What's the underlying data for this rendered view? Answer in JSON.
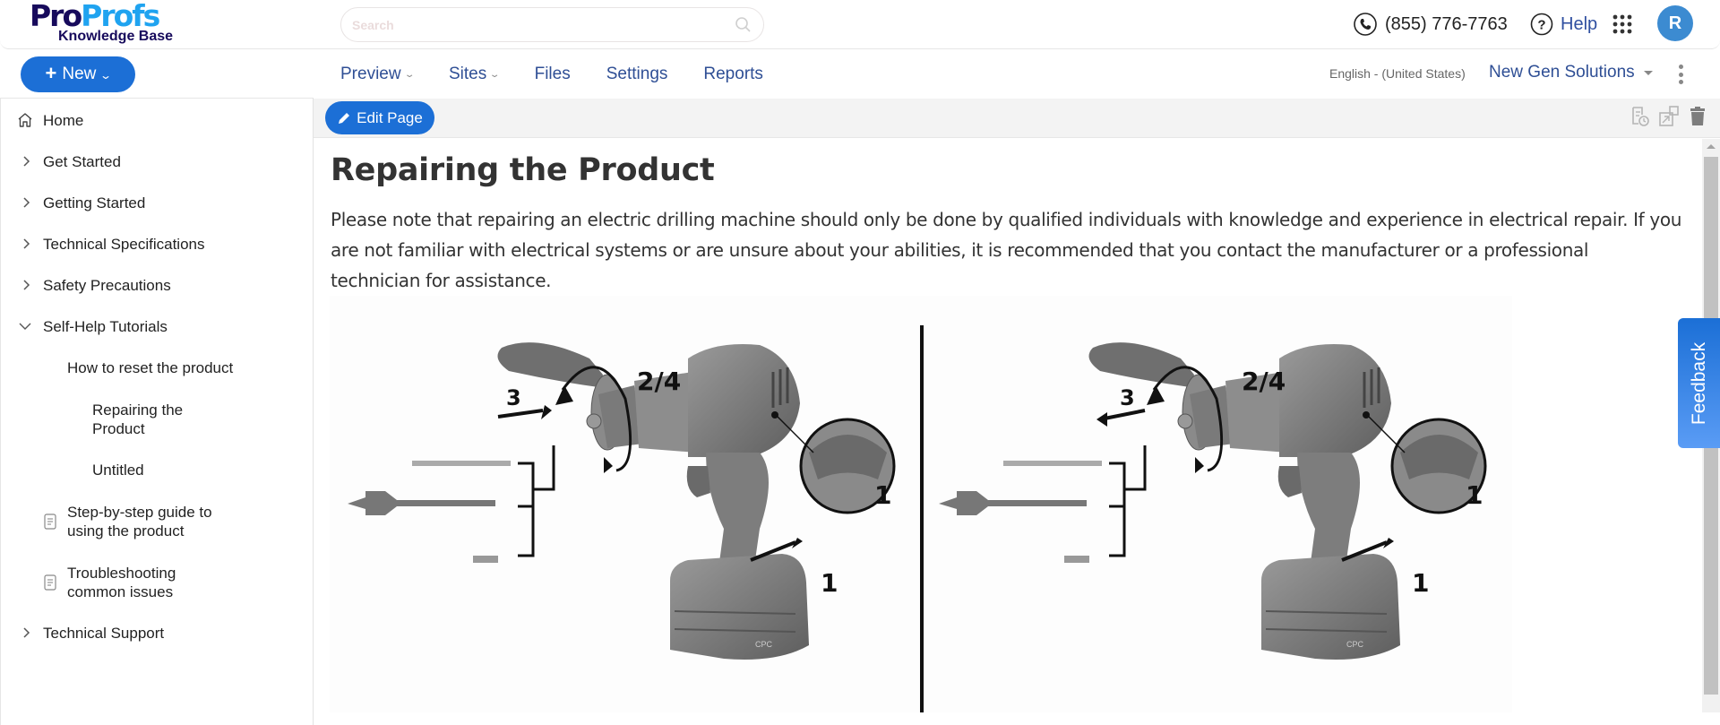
{
  "app": {
    "logo_pro": "Pro",
    "logo_profs": "Profs",
    "logo_subtitle": "Knowledge Base"
  },
  "header": {
    "search_placeholder": "Search",
    "search_value": "",
    "phone": "(855) 776-7763",
    "help_label": "Help",
    "avatar_initial": "R"
  },
  "nav": {
    "new_label": "New",
    "items": [
      {
        "label": "Preview",
        "dropdown": true
      },
      {
        "label": "Sites",
        "dropdown": true
      },
      {
        "label": "Files",
        "dropdown": false
      },
      {
        "label": "Settings",
        "dropdown": false
      },
      {
        "label": "Reports",
        "dropdown": false
      }
    ],
    "language": "English - (United States)",
    "organization": "New Gen Solutions"
  },
  "sidebar": {
    "items": [
      {
        "label": "Home",
        "icon": "home-icon",
        "level": 0
      },
      {
        "label": "Get Started",
        "icon": "chevron-right-icon",
        "level": 0
      },
      {
        "label": "Getting Started",
        "icon": "chevron-right-icon",
        "level": 0
      },
      {
        "label": "Technical Specifications",
        "icon": "chevron-right-icon",
        "level": 0
      },
      {
        "label": "Safety Precautions",
        "icon": "chevron-right-icon",
        "level": 0
      },
      {
        "label": "Self-Help Tutorials",
        "icon": "chevron-down-icon",
        "level": 0,
        "expanded": true
      },
      {
        "label": "How to reset the product",
        "level": 1
      },
      {
        "label": "Repairing the Product",
        "level": 2,
        "active": true
      },
      {
        "label": "Untitled",
        "level": 2
      },
      {
        "label": "Step-by-step guide to using the product",
        "icon": "document-icon",
        "level": 1
      },
      {
        "label": "Troubleshooting common issues",
        "icon": "document-icon",
        "level": 1
      },
      {
        "label": "Technical Support",
        "icon": "chevron-right-icon",
        "level": 0
      }
    ]
  },
  "toolbar": {
    "edit_label": "Edit Page",
    "icons": [
      "revision-history-icon",
      "open-external-icon",
      "trash-icon"
    ]
  },
  "article": {
    "title": "Repairing the Product",
    "paragraph": "Please note that repairing an electric drilling machine should only be done by qualified individuals with knowledge and experience in electrical repair. If you are not familiar with electrical systems or are unsure about your abilities, it is recommended that you contact the manufacturer or a professional technician for assistance.",
    "figure": {
      "description": "Two-panel diagram of cordless drill bit installation and removal",
      "panels": [
        {
          "labels": [
            "2/4",
            "3",
            "1",
            "1"
          ],
          "arrow3_direction": "in",
          "battery_text": "CPC"
        },
        {
          "labels": [
            "2/4",
            "3",
            "1",
            "1"
          ],
          "arrow3_direction": "out",
          "battery_text": "CPC"
        }
      ]
    }
  },
  "feedback_label": "Feedback",
  "colors": {
    "primary": "#1c6fd6",
    "nav_text": "#2f4f95",
    "logo_dark": "#170a5c",
    "logo_light": "#1fa3f0",
    "avatar": "#3c8bd1"
  }
}
